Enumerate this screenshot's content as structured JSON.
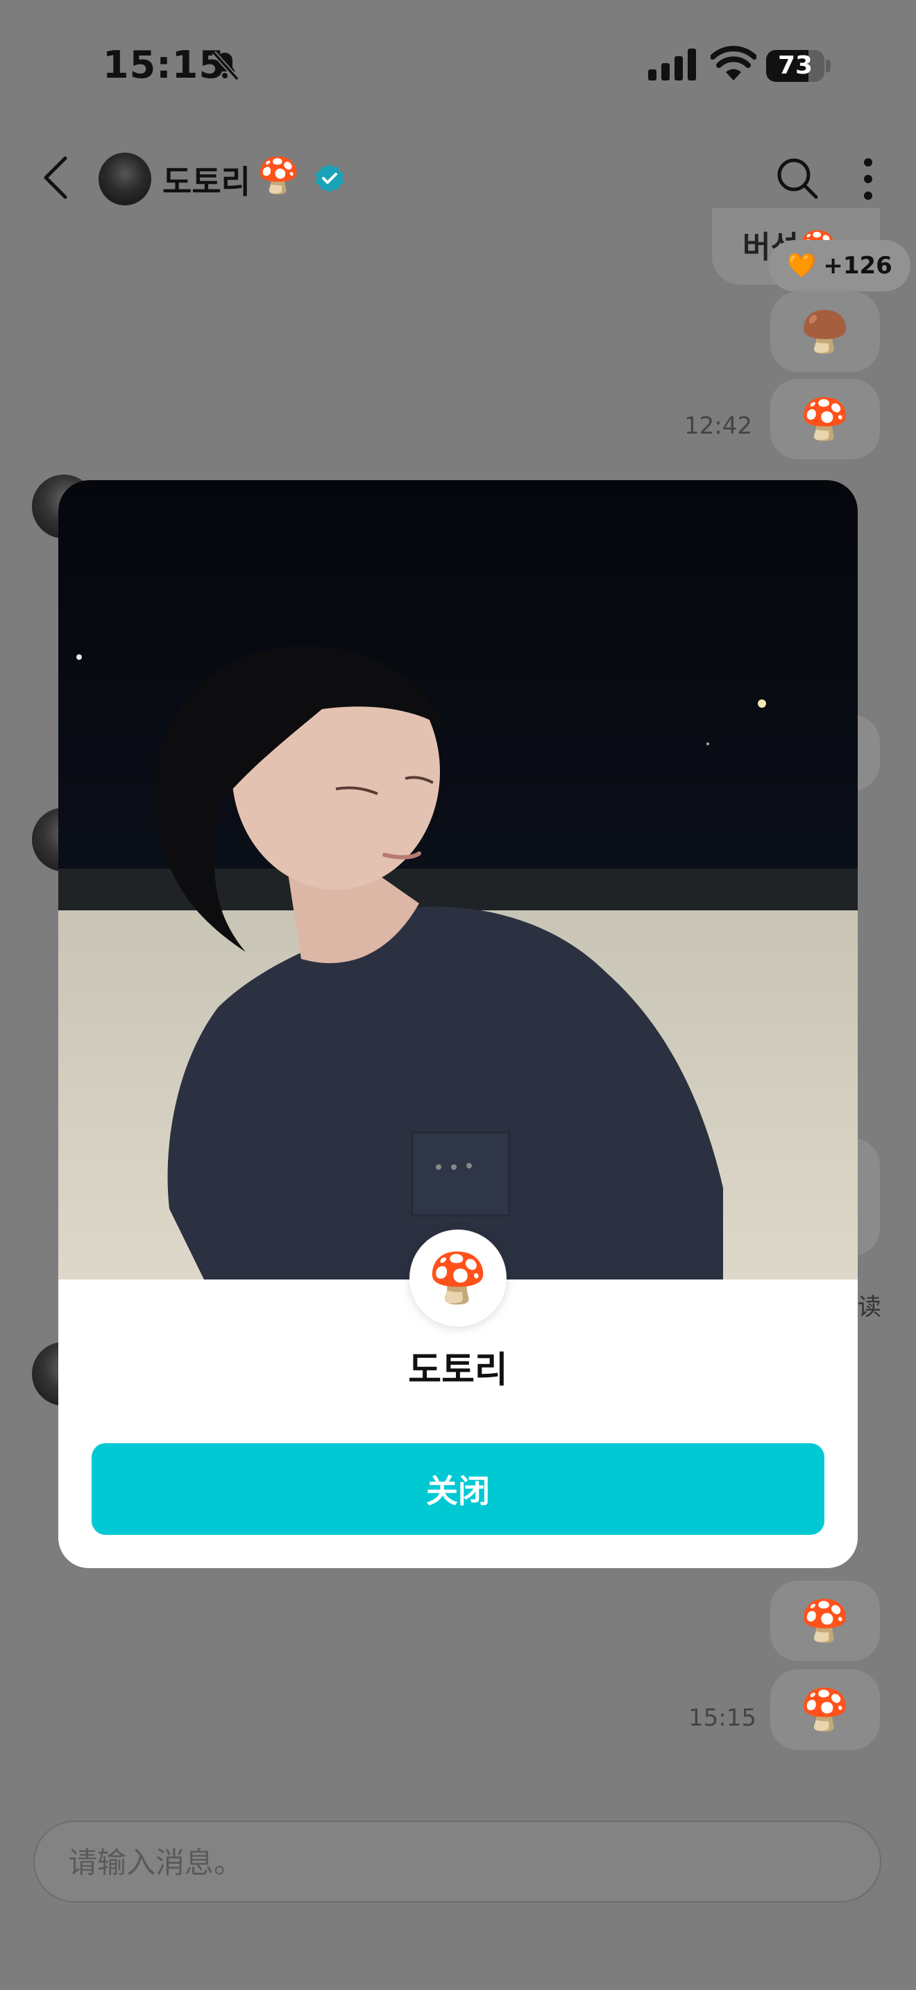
{
  "status_bar": {
    "time": "15:15",
    "battery": "73",
    "battery_level": 0.73
  },
  "header": {
    "contact_name": "도토리",
    "contact_emoji": "🍄",
    "icons": [
      "back-arrow-icon",
      "verified-icon",
      "search-icon",
      "more-vertical-icon"
    ]
  },
  "chat": {
    "partial_message": "버섯🍄",
    "reaction_badge": {
      "emoji": "🧡",
      "count": "+126"
    },
    "messages": [
      {
        "emoji": "🍄‍🟫"
      },
      {
        "emoji": "🍄",
        "time": "12:42"
      },
      {
        "emoji": "🍄"
      },
      {
        "emoji": "🍄",
        "time": "15:15"
      }
    ],
    "read_mark": "读"
  },
  "input": {
    "placeholder": "请输入消息。"
  },
  "modal": {
    "name": "도토리",
    "badge_emoji": "🍄",
    "close_label": "关闭"
  },
  "colors": {
    "accent": "#00c9d4",
    "overlay": "#7d7d7d",
    "verified": "#1aa3b8"
  }
}
